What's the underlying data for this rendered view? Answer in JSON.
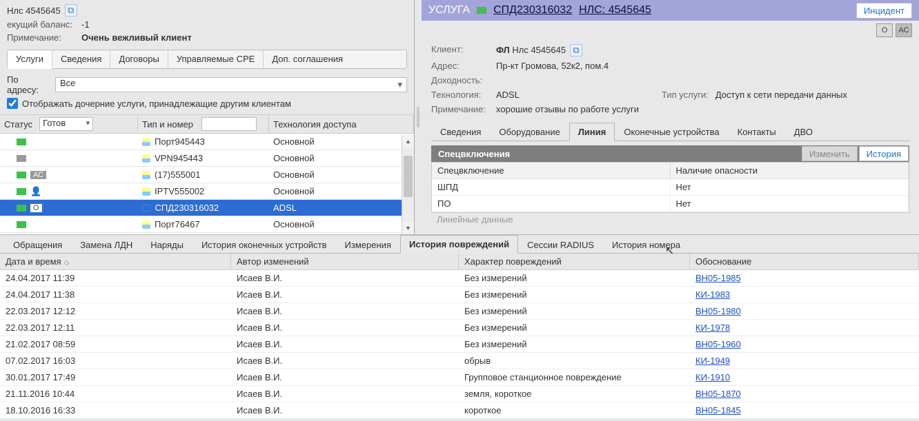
{
  "left": {
    "nls_label": "Нлс 4545645",
    "balance_lbl": "екущий баланс:",
    "balance_val": "-1",
    "note_lbl": "Примечание:",
    "note_val": "Очень вежливый клиент",
    "tabs": [
      "Услуги",
      "Сведения",
      "Договоры",
      "Управляемые CPE",
      "Доп. соглашения"
    ],
    "by_addr_lbl1": "По",
    "by_addr_lbl2": "адресу:",
    "by_addr_val": "Все",
    "show_children": "Отображать дочерние услуги, принадлежащие другим клиентам",
    "grid_hdr": {
      "status": "Статус",
      "status_val": "Готов",
      "type": "Тип и номер",
      "tech": "Технология доступа"
    },
    "rows": [
      {
        "sq": "green",
        "pill": "",
        "name": "Порт945443",
        "tech": "Основной",
        "icon": "node"
      },
      {
        "sq": "grey",
        "pill": "",
        "name": "VPN945443",
        "tech": "Основной",
        "icon": "node"
      },
      {
        "sq": "green",
        "pill": "АС",
        "name": "(17)555001",
        "tech": "Основной",
        "icon": "node"
      },
      {
        "sq": "green",
        "pill": "",
        "user": true,
        "name": "IPTV555002",
        "tech": "Основной",
        "icon": "node"
      },
      {
        "sq": "green",
        "pill": "О",
        "name": "СПД230316032",
        "tech": "ADSL",
        "icon": "mon",
        "active": true
      },
      {
        "sq": "green",
        "pill": "",
        "name": "Порт76467",
        "tech": "Основной",
        "icon": "node"
      }
    ]
  },
  "right": {
    "title": "УСЛУГА",
    "svc_link": "СПД230316032",
    "nls_link": "НЛС: 4545645",
    "incident": "Инцидент",
    "badges": [
      "О",
      "АС"
    ],
    "info": {
      "client_lbl": "Клиент:",
      "client_val_b": "ФЛ",
      "client_val": "Нлс 4545645",
      "addr_lbl": "Адрес:",
      "addr_val": "Пр-кт Громова, 52к2, пом.4",
      "inc_lbl": "Доходность:",
      "inc_val": "",
      "tech_lbl": "Технология:",
      "tech_val": "ADSL",
      "svctype_lbl": "Тип услуги:",
      "svctype_val": "Доступ к сети передачи данных",
      "note_lbl": "Примечание:",
      "note_val": "хорошие отзывы по работе услуги"
    },
    "rtabs": [
      "Сведения",
      "Оборудование",
      "Линия",
      "Оконечные устройства",
      "Контакты",
      "ДВО"
    ],
    "spec_title": "Спецвключения",
    "spec_edit": "Изменить",
    "spec_hist": "История",
    "spec_hd": [
      "Спецвключение",
      "Наличие опасности"
    ],
    "spec_rows": [
      [
        "ШПД",
        "Нет"
      ],
      [
        "ПО",
        "Нет"
      ]
    ],
    "cut": "Линейные данные"
  },
  "bottom": {
    "tabs": [
      "Обращения",
      "Замена ЛДН",
      "Наряды",
      "История оконечных устройств",
      "Измерения",
      "История повреждений",
      "Сессии RADIUS",
      "История номера"
    ],
    "hdr": {
      "dt": "Дата и время",
      "au": "Автор изменений",
      "ch": "Характер повреждений",
      "ob": "Обоснование"
    },
    "rows": [
      {
        "dt": "24.04.2017 11:39",
        "au": "Исаев В.И.",
        "ch": "Без измерений",
        "ob": "ВН05-1985"
      },
      {
        "dt": "24.04.2017 11:38",
        "au": "Исаев В.И.",
        "ch": "Без измерений",
        "ob": "КИ-1983"
      },
      {
        "dt": "22.03.2017 12:12",
        "au": "Исаев В.И.",
        "ch": "Без измерений",
        "ob": "ВН05-1980"
      },
      {
        "dt": "22.03.2017 12:11",
        "au": "Исаев В.И.",
        "ch": "Без измерений",
        "ob": "КИ-1978"
      },
      {
        "dt": "21.02.2017 08:59",
        "au": "Исаев В.И.",
        "ch": "Без измерений",
        "ob": "ВН05-1960"
      },
      {
        "dt": "07.02.2017 16:03",
        "au": "Исаев В.И.",
        "ch": "обрыв",
        "ob": "КИ-1949"
      },
      {
        "dt": "30.01.2017 17:49",
        "au": "Исаев В.И.",
        "ch": "Групповое станционное повреждение",
        "ob": "КИ-1910"
      },
      {
        "dt": "21.11.2016 10:44",
        "au": "Исаев В.И.",
        "ch": "земля, короткое",
        "ob": "ВН05-1870"
      },
      {
        "dt": "18.10.2016 16:33",
        "au": "Исаев В.И.",
        "ch": "короткое",
        "ob": "ВН05-1845"
      }
    ]
  }
}
